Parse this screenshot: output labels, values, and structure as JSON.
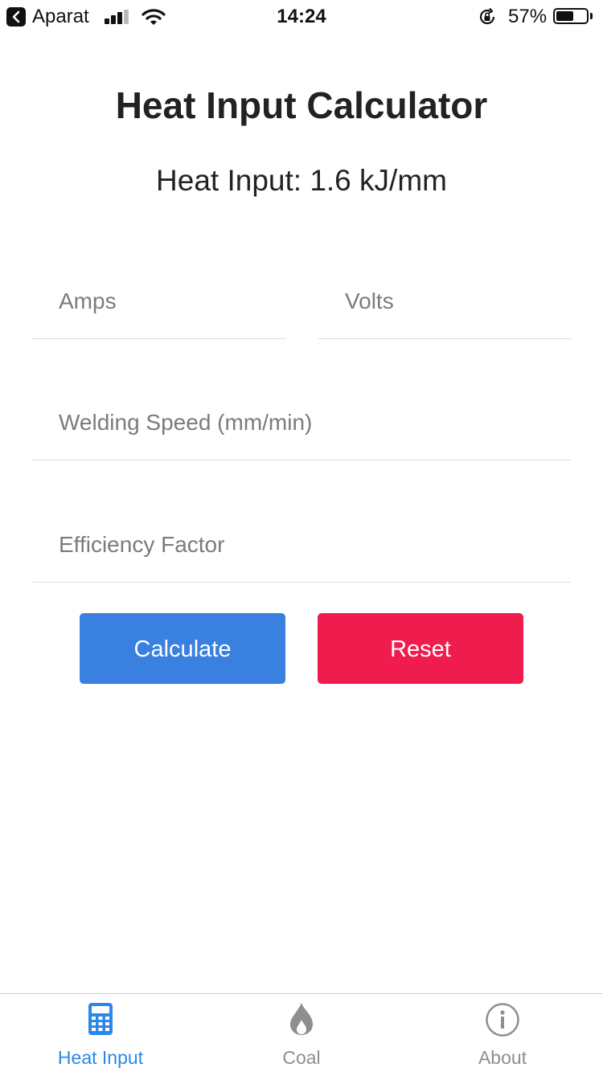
{
  "status_bar": {
    "back_app": "Aparat",
    "time": "14:24",
    "battery_percent": "57%",
    "battery_level": 0.57,
    "signal_bars": 3
  },
  "main": {
    "title": "Heat Input Calculator",
    "result": "Heat Input: 1.6 kJ/mm",
    "fields": {
      "amps_placeholder": "Amps",
      "amps_value": "",
      "volts_placeholder": "Volts",
      "volts_value": "",
      "speed_placeholder": "Welding Speed (mm/min)",
      "speed_value": "",
      "efficiency_placeholder": "Efficiency Factor",
      "efficiency_value": ""
    },
    "buttons": {
      "calculate": "Calculate",
      "reset": "Reset"
    }
  },
  "colors": {
    "calculate_bg": "#3a80e0",
    "reset_bg": "#ef1c4d",
    "active_tab": "#2b88e8",
    "inactive_tab": "#8e8e8e"
  },
  "tab_bar": {
    "tabs": [
      {
        "label": "Heat Input",
        "icon": "calculator-icon",
        "active": true
      },
      {
        "label": "Coal",
        "icon": "flame-icon",
        "active": false
      },
      {
        "label": "About",
        "icon": "info-icon",
        "active": false
      }
    ]
  }
}
